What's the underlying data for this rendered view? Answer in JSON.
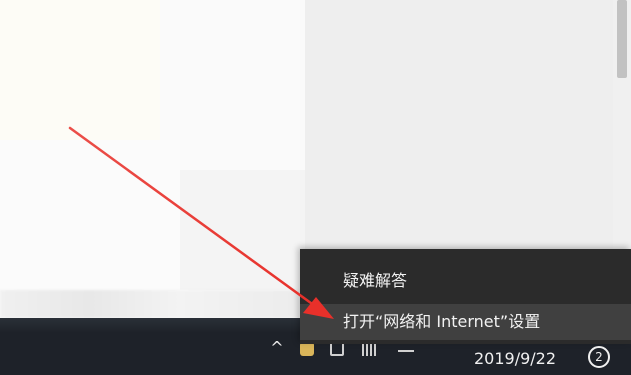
{
  "context_menu": {
    "items": [
      {
        "label": "疑难解答"
      },
      {
        "label": "打开“网络和 Internet”设置",
        "highlighted": true
      }
    ]
  },
  "taskbar": {
    "tray_chevron_icon": "chevron-up-icon",
    "date": "2019/9/22",
    "notification_count": "2"
  },
  "annotation": {
    "arrow_color": "#e8302a"
  }
}
